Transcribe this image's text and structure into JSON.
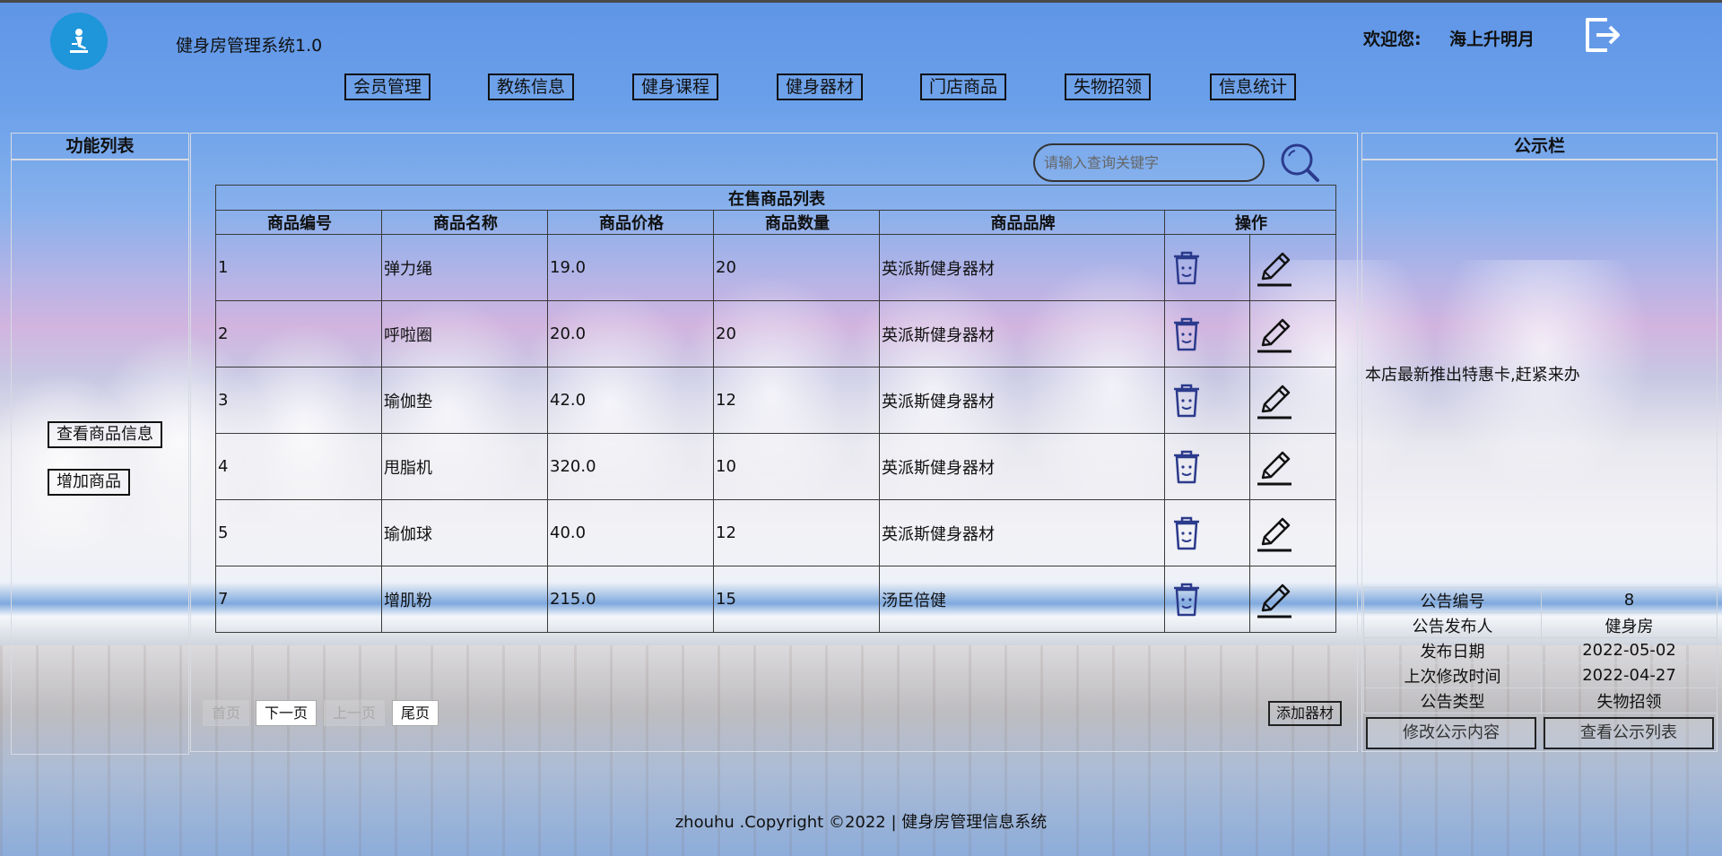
{
  "header": {
    "app_title": "健身房管理系统1.0",
    "welcome_label": "欢迎您:",
    "username": "海上升明月"
  },
  "nav": [
    {
      "label": "会员管理"
    },
    {
      "label": "教练信息"
    },
    {
      "label": "健身课程"
    },
    {
      "label": "健身器材"
    },
    {
      "label": "门店商品"
    },
    {
      "label": "失物招领"
    },
    {
      "label": "信息统计"
    }
  ],
  "sidebar": {
    "title": "功能列表",
    "buttons": [
      {
        "label": "查看商品信息"
      },
      {
        "label": "增加商品"
      }
    ]
  },
  "main": {
    "search_placeholder": "请输入查询关键字",
    "table_title": "在售商品列表",
    "columns": [
      "商品编号",
      "商品名称",
      "商品价格",
      "商品数量",
      "商品品牌",
      "操作"
    ],
    "rows": [
      {
        "id": "1",
        "name": "弹力绳",
        "price": "19.0",
        "qty": "20",
        "brand": "英派斯健身器材"
      },
      {
        "id": "2",
        "name": "呼啦圈",
        "price": "20.0",
        "qty": "20",
        "brand": "英派斯健身器材"
      },
      {
        "id": "3",
        "name": "瑜伽垫",
        "price": "42.0",
        "qty": "12",
        "brand": "英派斯健身器材"
      },
      {
        "id": "4",
        "name": "甩脂机",
        "price": "320.0",
        "qty": "10",
        "brand": "英派斯健身器材"
      },
      {
        "id": "5",
        "name": "瑜伽球",
        "price": "40.0",
        "qty": "12",
        "brand": "英派斯健身器材"
      },
      {
        "id": "7",
        "name": "增肌粉",
        "price": "215.0",
        "qty": "15",
        "brand": "汤臣倍健"
      }
    ],
    "pagination": {
      "first": "首页",
      "next": "下一页",
      "prev": "上一页",
      "last": "尾页"
    },
    "add_button": "添加器材"
  },
  "notice": {
    "title": "公示栏",
    "content": "本店最新推出特惠卡,赶紧来办",
    "fields": [
      {
        "label": "公告编号",
        "value": "8"
      },
      {
        "label": "公告发布人",
        "value": "健身房"
      },
      {
        "label": "发布日期",
        "value": "2022-05-02"
      },
      {
        "label": "上次修改时间",
        "value": "2022-04-27"
      },
      {
        "label": "公告类型",
        "value": "失物招领"
      }
    ],
    "edit_button": "修改公示内容",
    "list_button": "查看公示列表"
  },
  "footer": {
    "text": "zhouhu .Copyright ©2022 | 健身房管理信息系统"
  },
  "colors": {
    "logo_bg": "#1f95da",
    "icon_blue": "#2b3a8c"
  },
  "icons": {
    "delete": "trash-icon",
    "edit": "pencil-icon",
    "search": "search-icon",
    "logout": "logout-icon",
    "logo": "gym-logo-icon"
  }
}
